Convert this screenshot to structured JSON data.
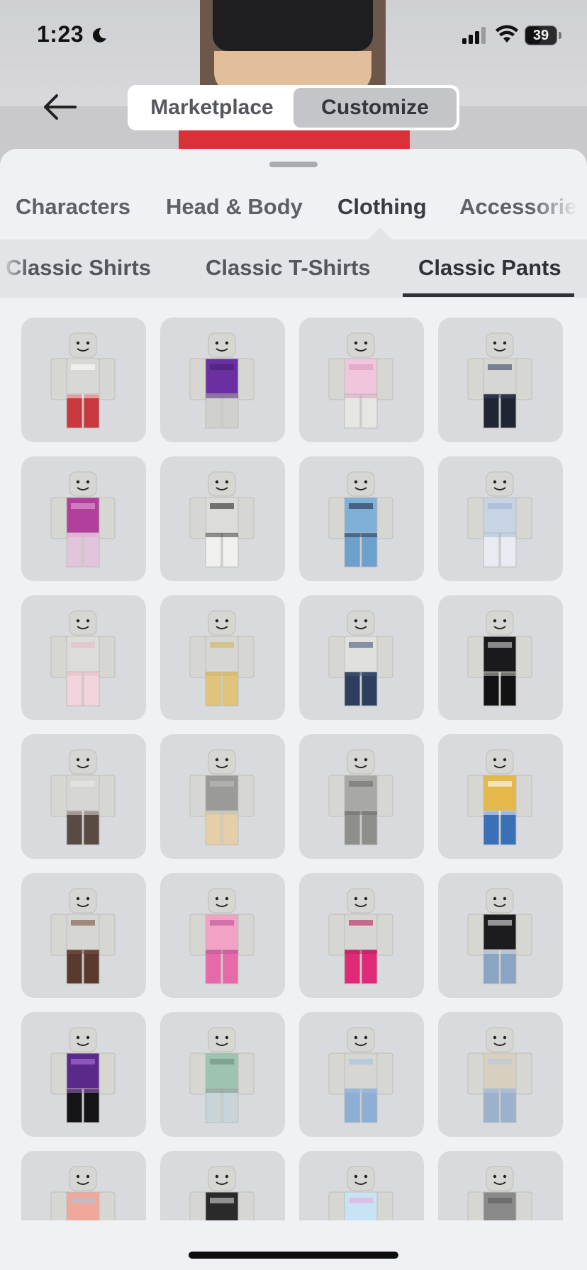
{
  "status_bar": {
    "time": "1:23",
    "battery": "39",
    "icons": [
      "moon-icon",
      "cellular-signal-icon",
      "wifi-icon",
      "battery-icon"
    ]
  },
  "nav": {
    "back_icon": "arrow-left-icon",
    "segments": [
      {
        "label": "Marketplace",
        "active": false
      },
      {
        "label": "Customize",
        "active": true
      }
    ]
  },
  "categories": [
    {
      "label": "Characters",
      "active": false
    },
    {
      "label": "Head & Body",
      "active": false
    },
    {
      "label": "Clothing",
      "active": true
    },
    {
      "label": "Accessories",
      "active": false
    }
  ],
  "subcategories": [
    {
      "label": "Classic Shirts",
      "active": false
    },
    {
      "label": "Classic T-Shirts",
      "active": false
    },
    {
      "label": "Classic Pants",
      "active": true
    }
  ],
  "items": [
    {
      "shirt": "#d8d8d4",
      "pants": "#c8383e",
      "accent": "#ffffff"
    },
    {
      "shirt": "#6a2fa0",
      "pants": "#d0d0cc",
      "accent": "#4a1f78"
    },
    {
      "shirt": "#f0c6dc",
      "pants": "#e6e6e4",
      "accent": "#d99cc0"
    },
    {
      "shirt": "#d6d6d2",
      "pants": "#1f2533",
      "accent": "#3a4560"
    },
    {
      "shirt": "#b0409c",
      "pants": "#e2c4dc",
      "accent": "#e6a2d8"
    },
    {
      "shirt": "#dcdcd8",
      "pants": "#f0f0ee",
      "accent": "#2a2a2a"
    },
    {
      "shirt": "#7fb0d8",
      "pants": "#6ea0cc",
      "accent": "#20324a"
    },
    {
      "shirt": "#c8d4e4",
      "pants": "#e8ecf2",
      "accent": "#9fb6d2"
    },
    {
      "shirt": "#dcdcd8",
      "pants": "#f2d4dc",
      "accent": "#e8bcc8"
    },
    {
      "shirt": "#d6d6d2",
      "pants": "#e0c47c",
      "accent": "#d2b460"
    },
    {
      "shirt": "#e0e0de",
      "pants": "#2e3e5e",
      "accent": "#46587a"
    },
    {
      "shirt": "#1a1a1c",
      "pants": "#121214",
      "accent": "#d6d6d2"
    },
    {
      "shirt": "#d6d6d2",
      "pants": "#5a4a44",
      "accent": "#e8e8e6"
    },
    {
      "shirt": "#9a9a98",
      "pants": "#e4cfa8",
      "accent": "#c0c0be"
    },
    {
      "shirt": "#a8a8a6",
      "pants": "#8e8e8c",
      "accent": "#6e6e6c"
    },
    {
      "shirt": "#e4b84a",
      "pants": "#3a70b8",
      "accent": "#ffffff"
    },
    {
      "shirt": "#d6d6d2",
      "pants": "#5a3a2e",
      "accent": "#7a5446"
    },
    {
      "shirt": "#f2a2c4",
      "pants": "#e66aa8",
      "accent": "#c0509a"
    },
    {
      "shirt": "#d6d6d2",
      "pants": "#e02a78",
      "accent": "#b81e60"
    },
    {
      "shirt": "#1c1c1e",
      "pants": "#8aa4c4",
      "accent": "#e6e6e4"
    },
    {
      "shirt": "#5a2a8a",
      "pants": "#141416",
      "accent": "#b070e0"
    },
    {
      "shirt": "#9cc4b0",
      "pants": "#c8d4d8",
      "accent": "#6c8c80"
    },
    {
      "shirt": "#d6d6d2",
      "pants": "#8eaed4",
      "accent": "#a4c0e0"
    },
    {
      "shirt": "#d8cfc0",
      "pants": "#9cb2cc",
      "accent": "#b8c8dc"
    },
    {
      "shirt": "#f0a89a",
      "pants": "#d6d6d2",
      "accent": "#a8c4e0"
    },
    {
      "shirt": "#2a2a2a",
      "pants": "#6a4a3a",
      "accent": "#d6d6d2"
    },
    {
      "shirt": "#c8e4f4",
      "pants": "#d6d6d2",
      "accent": "#e6a8d8"
    },
    {
      "shirt": "#8a8a8a",
      "pants": "#d6d6d2",
      "accent": "#5a5a5a"
    }
  ]
}
